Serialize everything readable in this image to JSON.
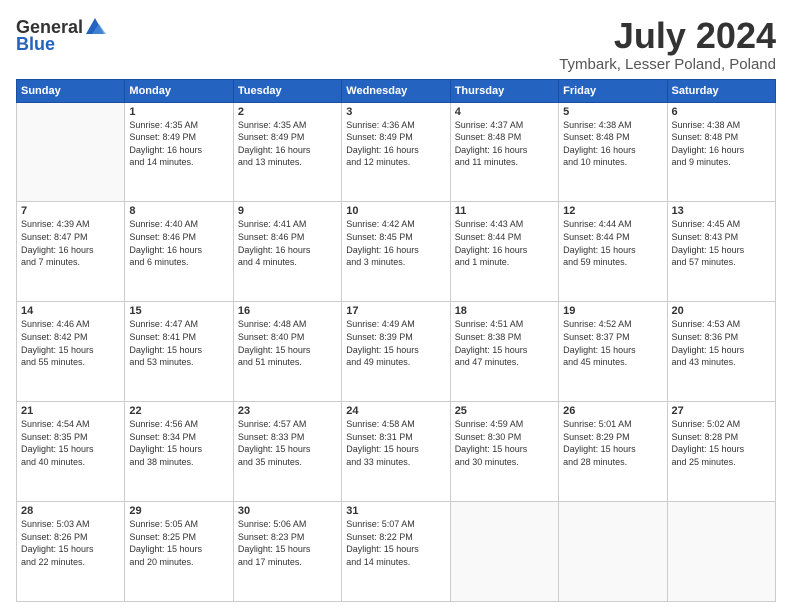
{
  "logo": {
    "general": "General",
    "blue": "Blue"
  },
  "header": {
    "month_year": "July 2024",
    "location": "Tymbark, Lesser Poland, Poland"
  },
  "weekdays": [
    "Sunday",
    "Monday",
    "Tuesday",
    "Wednesday",
    "Thursday",
    "Friday",
    "Saturday"
  ],
  "weeks": [
    [
      {
        "day": "",
        "info": ""
      },
      {
        "day": "1",
        "info": "Sunrise: 4:35 AM\nSunset: 8:49 PM\nDaylight: 16 hours\nand 14 minutes."
      },
      {
        "day": "2",
        "info": "Sunrise: 4:35 AM\nSunset: 8:49 PM\nDaylight: 16 hours\nand 13 minutes."
      },
      {
        "day": "3",
        "info": "Sunrise: 4:36 AM\nSunset: 8:49 PM\nDaylight: 16 hours\nand 12 minutes."
      },
      {
        "day": "4",
        "info": "Sunrise: 4:37 AM\nSunset: 8:48 PM\nDaylight: 16 hours\nand 11 minutes."
      },
      {
        "day": "5",
        "info": "Sunrise: 4:38 AM\nSunset: 8:48 PM\nDaylight: 16 hours\nand 10 minutes."
      },
      {
        "day": "6",
        "info": "Sunrise: 4:38 AM\nSunset: 8:48 PM\nDaylight: 16 hours\nand 9 minutes."
      }
    ],
    [
      {
        "day": "7",
        "info": "Sunrise: 4:39 AM\nSunset: 8:47 PM\nDaylight: 16 hours\nand 7 minutes."
      },
      {
        "day": "8",
        "info": "Sunrise: 4:40 AM\nSunset: 8:46 PM\nDaylight: 16 hours\nand 6 minutes."
      },
      {
        "day": "9",
        "info": "Sunrise: 4:41 AM\nSunset: 8:46 PM\nDaylight: 16 hours\nand 4 minutes."
      },
      {
        "day": "10",
        "info": "Sunrise: 4:42 AM\nSunset: 8:45 PM\nDaylight: 16 hours\nand 3 minutes."
      },
      {
        "day": "11",
        "info": "Sunrise: 4:43 AM\nSunset: 8:44 PM\nDaylight: 16 hours\nand 1 minute."
      },
      {
        "day": "12",
        "info": "Sunrise: 4:44 AM\nSunset: 8:44 PM\nDaylight: 15 hours\nand 59 minutes."
      },
      {
        "day": "13",
        "info": "Sunrise: 4:45 AM\nSunset: 8:43 PM\nDaylight: 15 hours\nand 57 minutes."
      }
    ],
    [
      {
        "day": "14",
        "info": "Sunrise: 4:46 AM\nSunset: 8:42 PM\nDaylight: 15 hours\nand 55 minutes."
      },
      {
        "day": "15",
        "info": "Sunrise: 4:47 AM\nSunset: 8:41 PM\nDaylight: 15 hours\nand 53 minutes."
      },
      {
        "day": "16",
        "info": "Sunrise: 4:48 AM\nSunset: 8:40 PM\nDaylight: 15 hours\nand 51 minutes."
      },
      {
        "day": "17",
        "info": "Sunrise: 4:49 AM\nSunset: 8:39 PM\nDaylight: 15 hours\nand 49 minutes."
      },
      {
        "day": "18",
        "info": "Sunrise: 4:51 AM\nSunset: 8:38 PM\nDaylight: 15 hours\nand 47 minutes."
      },
      {
        "day": "19",
        "info": "Sunrise: 4:52 AM\nSunset: 8:37 PM\nDaylight: 15 hours\nand 45 minutes."
      },
      {
        "day": "20",
        "info": "Sunrise: 4:53 AM\nSunset: 8:36 PM\nDaylight: 15 hours\nand 43 minutes."
      }
    ],
    [
      {
        "day": "21",
        "info": "Sunrise: 4:54 AM\nSunset: 8:35 PM\nDaylight: 15 hours\nand 40 minutes."
      },
      {
        "day": "22",
        "info": "Sunrise: 4:56 AM\nSunset: 8:34 PM\nDaylight: 15 hours\nand 38 minutes."
      },
      {
        "day": "23",
        "info": "Sunrise: 4:57 AM\nSunset: 8:33 PM\nDaylight: 15 hours\nand 35 minutes."
      },
      {
        "day": "24",
        "info": "Sunrise: 4:58 AM\nSunset: 8:31 PM\nDaylight: 15 hours\nand 33 minutes."
      },
      {
        "day": "25",
        "info": "Sunrise: 4:59 AM\nSunset: 8:30 PM\nDaylight: 15 hours\nand 30 minutes."
      },
      {
        "day": "26",
        "info": "Sunrise: 5:01 AM\nSunset: 8:29 PM\nDaylight: 15 hours\nand 28 minutes."
      },
      {
        "day": "27",
        "info": "Sunrise: 5:02 AM\nSunset: 8:28 PM\nDaylight: 15 hours\nand 25 minutes."
      }
    ],
    [
      {
        "day": "28",
        "info": "Sunrise: 5:03 AM\nSunset: 8:26 PM\nDaylight: 15 hours\nand 22 minutes."
      },
      {
        "day": "29",
        "info": "Sunrise: 5:05 AM\nSunset: 8:25 PM\nDaylight: 15 hours\nand 20 minutes."
      },
      {
        "day": "30",
        "info": "Sunrise: 5:06 AM\nSunset: 8:23 PM\nDaylight: 15 hours\nand 17 minutes."
      },
      {
        "day": "31",
        "info": "Sunrise: 5:07 AM\nSunset: 8:22 PM\nDaylight: 15 hours\nand 14 minutes."
      },
      {
        "day": "",
        "info": ""
      },
      {
        "day": "",
        "info": ""
      },
      {
        "day": "",
        "info": ""
      }
    ]
  ]
}
